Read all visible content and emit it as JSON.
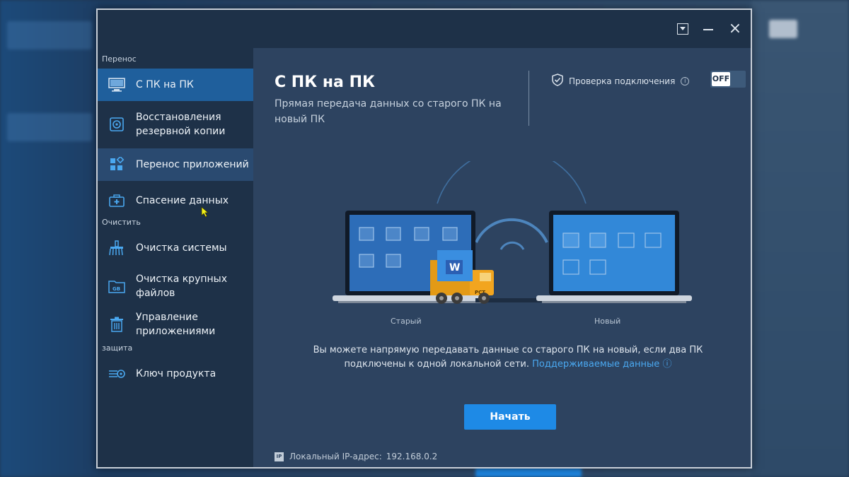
{
  "window": {
    "controls": {
      "menu": "menu-icon",
      "minimize": "minimize-icon",
      "close": "×"
    }
  },
  "sidebar": {
    "sections": [
      {
        "label": "Перенос"
      },
      {
        "label": "Очистить"
      },
      {
        "label": "защита"
      }
    ],
    "items": [
      {
        "label": "С ПК на ПК",
        "icon": "monitor-icon",
        "active": true
      },
      {
        "label": "Восстановления резервной копии",
        "icon": "backup-restore-icon"
      },
      {
        "label": "Перенос приложений",
        "icon": "apps-grid-icon",
        "hover": true
      },
      {
        "label": "Спасение данных",
        "icon": "briefcase-plus-icon"
      },
      {
        "label": "Очистка системы",
        "icon": "broom-icon"
      },
      {
        "label": "Очистка крупных файлов",
        "icon": "folder-gb-icon"
      },
      {
        "label": "Управление приложениями",
        "icon": "trash-icon"
      },
      {
        "label": "Ключ продукта",
        "icon": "key-icon"
      }
    ]
  },
  "main": {
    "title": "С ПК на ПК",
    "subtitle": "Прямая передача данных со старого ПК на новый ПК",
    "connection_check": {
      "label": "Проверка подключения",
      "info": "i",
      "toggle": "OFF"
    },
    "illustration": {
      "old_label": "Старый",
      "new_label": "Новый",
      "truck_label": "PCT",
      "doc_letter": "W"
    },
    "description": "Вы можете напрямую передавать данные со старого ПК на новый, если два ПК подключены к одной локальной сети.",
    "supported_link": "Поддерживаемые данные",
    "supported_link_icon": "ⓘ",
    "start_button": "Начать",
    "ip": {
      "badge": "IP",
      "label": "Локальный IP-адрес:",
      "value": "192.168.0.2"
    }
  },
  "colors": {
    "accent": "#1e8ae6",
    "sidebar_bg": "#1e3148",
    "active_item": "#1f5f9c",
    "main_bg": "#2d4360",
    "link": "#4aa8f0",
    "truck": "#f2a51f"
  }
}
